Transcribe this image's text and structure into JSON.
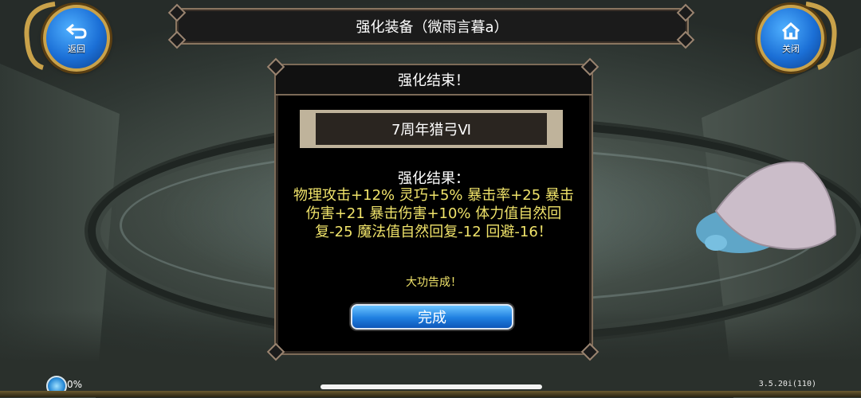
{
  "header": {
    "title": "强化装备（微雨言暮a）",
    "back_label": "返回",
    "close_label": "关闭"
  },
  "dialog": {
    "title": "强化结束！",
    "item_name": "7周年猎弓Ⅵ",
    "result_title": "强化结果：",
    "result_text": "物理攻击+12% 灵巧+5% 暴击率+25 暴击伤害+21 暴击伤害+10% 体力值自然回复-25 魔法值自然回复-12 回避-16！",
    "success_text": "大功告成！",
    "done_label": "完成"
  },
  "status": {
    "loading_percent": "0%",
    "version": "3.5.20i(110)"
  },
  "colors": {
    "result_text": "#f0e36a",
    "button_blue": "#1f7fe0",
    "frame": "#7d6b58"
  }
}
